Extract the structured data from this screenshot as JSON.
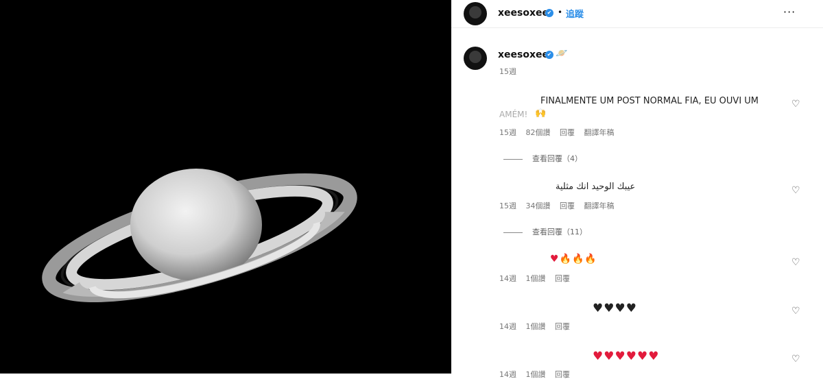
{
  "post": {
    "username": "xeesoxee",
    "follow_label": "追蹤",
    "dot": "•",
    "more_label": "···",
    "verified_glyph": "✔"
  },
  "caption": {
    "username": "xeesoxee",
    "emoji": "🪐",
    "age": "15週"
  },
  "comments": [
    {
      "text_line1": "FINALMENTE UM POST NORMAL FIA, EU OUVI UM",
      "text_line2": "AMÉM!",
      "text_emoji": "🙌",
      "age": "15週",
      "likes": "82個讚",
      "reply": "回覆",
      "translate": "翻譯年稿",
      "view_replies": "查看回覆（4）"
    },
    {
      "text": "عيبك الوحيد انك مثلية",
      "age": "15週",
      "likes": "34個讚",
      "reply": "回覆",
      "translate": "翻譯年稿",
      "view_replies": "查看回覆（11）"
    },
    {
      "hearts": "♥",
      "flames": "🔥🔥🔥",
      "age": "14週",
      "likes": "1個讚",
      "reply": "回覆"
    },
    {
      "hearts": "♥♥♥♥",
      "age": "14週",
      "likes": "1個讚",
      "reply": "回覆"
    },
    {
      "hearts": "♥♥♥♥♥♥",
      "age": "14週",
      "likes": "1個讚",
      "reply": "回覆"
    }
  ],
  "icons": {
    "heart": "♡"
  },
  "colors": {
    "link": "#2b8ee8",
    "verified": "#2b8ee8",
    "photo_bg": "#000000"
  }
}
